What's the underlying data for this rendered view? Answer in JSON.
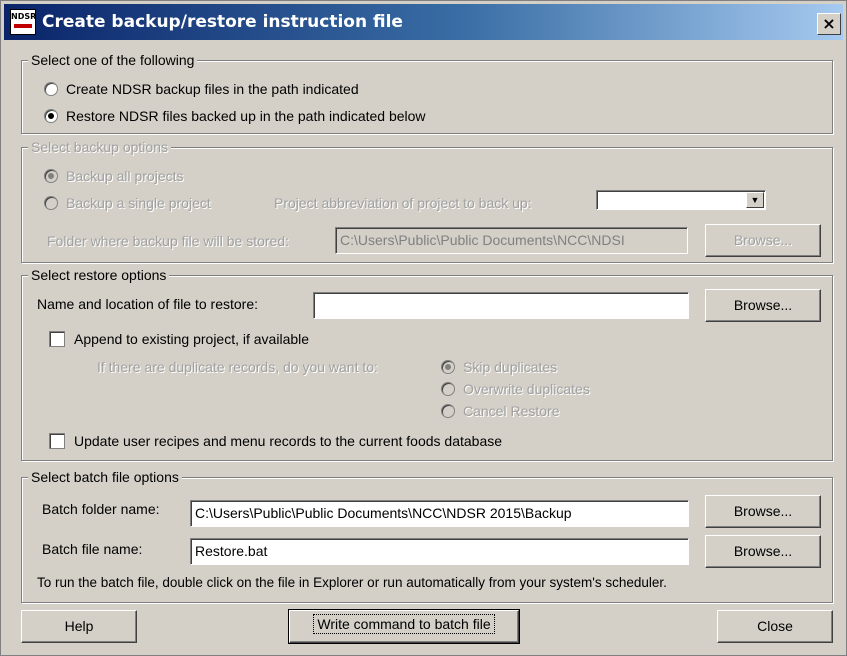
{
  "window": {
    "title": "Create backup/restore instruction file",
    "logo_text": "NDSR",
    "close_label": "×"
  },
  "select_one": {
    "legend": "Select one of the following",
    "options": [
      {
        "label": "Create NDSR backup files in the path indicated",
        "checked": false
      },
      {
        "label": "Restore NDSR files backed up in the path indicated below",
        "checked": true
      }
    ]
  },
  "backup_options": {
    "legend": "Select backup options",
    "backup_all_label": "Backup all projects",
    "backup_single_label": "Backup a single project",
    "project_abbrev_label": "Project abbreviation of project to back up:",
    "project_abbrev_value": "",
    "folder_label": "Folder where backup file will be stored:",
    "folder_value": "C:\\Users\\Public\\Public Documents\\NCC\\NDSI",
    "browse_label": "Browse..."
  },
  "restore_options": {
    "legend": "Select restore options",
    "file_label": "Name and location of file to restore:",
    "file_value": "",
    "browse_label": "Browse...",
    "append_label": "Append to existing project, if available",
    "duplicates_question": "If there are duplicate records, do you want to:",
    "duplicates_options": [
      {
        "label": "Skip duplicates",
        "checked": true
      },
      {
        "label": "Overwrite duplicates",
        "checked": false
      },
      {
        "label": "Cancel Restore",
        "checked": false
      }
    ],
    "update_label": "Update user recipes and menu records to the current foods database"
  },
  "batch_options": {
    "legend": "Select batch file options",
    "folder_label": "Batch folder name:",
    "folder_value": "C:\\Users\\Public\\Public Documents\\NCC\\NDSR 2015\\Backup",
    "file_label": "Batch file name:",
    "file_value": "Restore.bat",
    "browse_label": "Browse...",
    "hint": "To run the batch file, double click on the file in Explorer or run automatically from your system's scheduler."
  },
  "footer": {
    "help_label": "Help",
    "write_label": "Write command to batch file",
    "close_label": "Close"
  }
}
